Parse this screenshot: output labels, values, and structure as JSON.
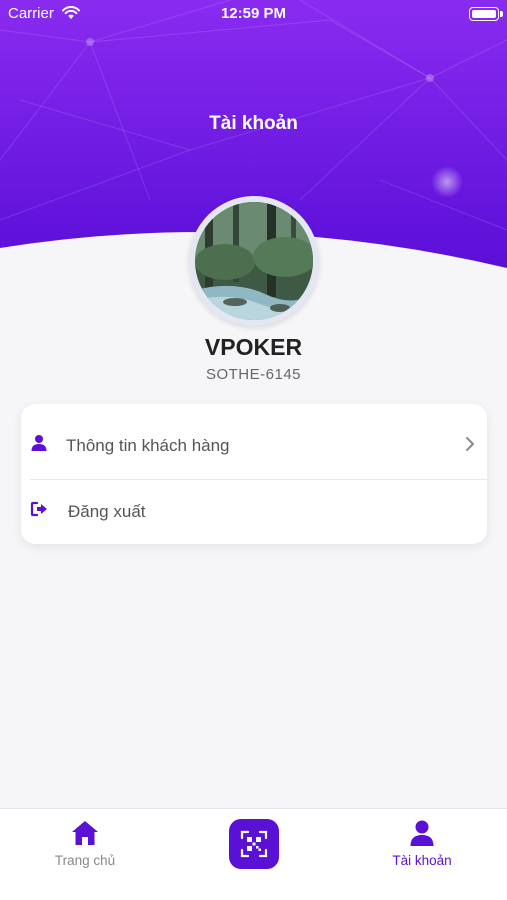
{
  "status_bar": {
    "carrier": "Carrier",
    "time": "12:59 PM"
  },
  "header": {
    "title": "Tài khoản"
  },
  "profile": {
    "name": "VPOKER",
    "id": "SOTHE-6145"
  },
  "menu": {
    "items": [
      {
        "label": "Thông tin khách hàng",
        "icon": "user-icon"
      },
      {
        "label": "Đăng xuất",
        "icon": "logout-icon"
      }
    ]
  },
  "tab_bar": {
    "items": [
      {
        "label": "Trang chủ",
        "icon": "home-icon",
        "active": false
      },
      {
        "label": "",
        "icon": "qr-scan-icon",
        "active": false
      },
      {
        "label": "Tài khoản",
        "icon": "user-icon",
        "active": true
      }
    ]
  },
  "colors": {
    "accent": "#5b10d6",
    "header_gradient_top": "#8a2bf0",
    "header_gradient_bottom": "#5a0fd8",
    "background": "#f6f6f8"
  }
}
